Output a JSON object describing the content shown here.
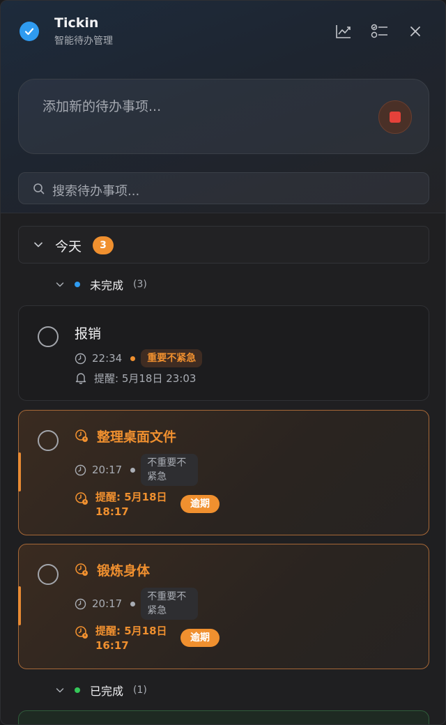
{
  "app": {
    "title": "Tickin",
    "subtitle": "智能待办管理"
  },
  "header_icons": [
    "checkmark-logo-icon",
    "chart-icon",
    "checklist-icon",
    "close-icon"
  ],
  "add_input": {
    "placeholder": "添加新的待办事项..."
  },
  "search": {
    "placeholder": "搜索待办事项..."
  },
  "group": {
    "title": "今天",
    "count": "3"
  },
  "sections": {
    "pending": {
      "label": "未完成",
      "count": "(3)",
      "color": "#2f9bf0"
    },
    "done": {
      "label": "已完成",
      "count": "(1)",
      "color": "#35c759"
    }
  },
  "tasks": [
    {
      "title": "报销",
      "time": "22:34",
      "tag": "重要不紧急",
      "reminder": "提醒: 5月18日 23:03",
      "overdue": false
    },
    {
      "title": "整理桌面文件",
      "time": "20:17",
      "tag": "不重要不紧急",
      "reminder": "提醒: 5月18日 18:17",
      "overdue": true,
      "overdue_label": "逾期"
    },
    {
      "title": "锻炼身体",
      "time": "20:17",
      "tag": "不重要不紧急",
      "reminder": "提醒: 5月18日 16:17",
      "overdue": true,
      "overdue_label": "逾期"
    }
  ],
  "colors": {
    "accent": "#2f9bf0",
    "warning": "#f0902f",
    "record": "#e5413a",
    "done": "#35c759"
  }
}
